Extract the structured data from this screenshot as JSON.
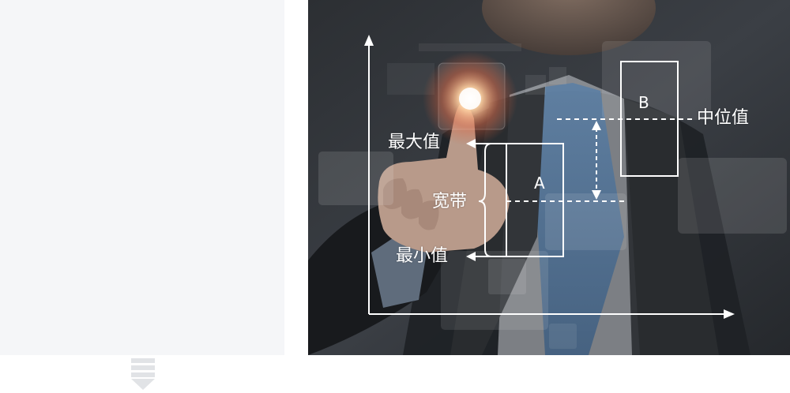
{
  "diagram": {
    "labels": {
      "max": "最大值",
      "min": "最小值",
      "bandwidth": "宽带",
      "median": "中位值",
      "box_a": "A",
      "box_b": "B"
    }
  },
  "scroll_indicator": {
    "icon": "arrow-down-icon",
    "color": "#e1e3e6"
  },
  "colors": {
    "left_panel_bg": "#f5f6f8",
    "line": "#ffffff"
  }
}
